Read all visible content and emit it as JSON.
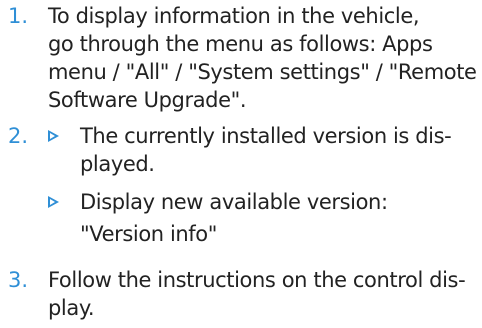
{
  "steps": [
    {
      "number": "1.",
      "lines": [
        "To display information in the vehicle,",
        "go through the menu as follows: Apps",
        "menu / \"All\" / \"System settings\" / \"Remote",
        "Software Upgrade\"."
      ]
    },
    {
      "number": "2.",
      "bullets": [
        {
          "lines": [
            "The currently installed version is dis-",
            "played."
          ]
        },
        {
          "lines": [
            "Display new available version:",
            "\"Version info\""
          ]
        }
      ]
    },
    {
      "number": "3.",
      "lines": [
        "Follow the instructions on the control dis-",
        "play."
      ]
    }
  ],
  "colors": {
    "accent": "#2f8fd6",
    "text": "#222222"
  },
  "icons": {
    "bullet": "triangle-bullet-icon"
  }
}
